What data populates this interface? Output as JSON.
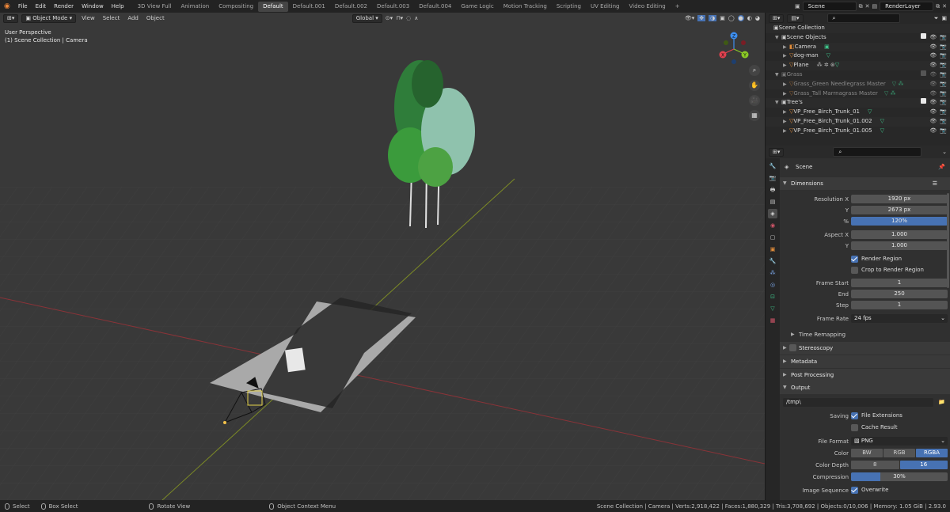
{
  "menubar": {
    "items": [
      "File",
      "Edit",
      "Render",
      "Window",
      "Help"
    ]
  },
  "workspaces": {
    "tabs": [
      "3D View Full",
      "Animation",
      "Compositing",
      "Default",
      "Default.001",
      "Default.002",
      "Default.003",
      "Default.004",
      "Game Logic",
      "Motion Tracking",
      "Scripting",
      "UV Editing",
      "Video Editing"
    ],
    "active": "Default",
    "add": "+"
  },
  "scene_field": "Scene",
  "layer_field": "RenderLayer",
  "viewport": {
    "mode": "Object Mode",
    "menus": [
      "View",
      "Select",
      "Add",
      "Object"
    ],
    "orientation": "Global",
    "perspective": "User Perspective",
    "context": "(1) Scene Collection | Camera",
    "gizmo": {
      "x": "X",
      "y": "Y",
      "z": "Z"
    }
  },
  "outliner": {
    "rows": [
      {
        "name": "Scene Collection",
        "level": 0,
        "type": "collection"
      },
      {
        "name": "Scene Objects",
        "level": 1,
        "type": "collection",
        "checked": true
      },
      {
        "name": "Camera",
        "level": 2,
        "type": "camera"
      },
      {
        "name": "dog-man",
        "level": 2,
        "type": "object"
      },
      {
        "name": "Plane",
        "level": 2,
        "type": "object"
      },
      {
        "name": "Grass",
        "level": 1,
        "type": "collection",
        "checked": false,
        "dim": true
      },
      {
        "name": "Grass_Green Needlegrass Master",
        "level": 2,
        "type": "object",
        "dim": true
      },
      {
        "name": "Grass_Tall Marrnagrass Master",
        "level": 2,
        "type": "object",
        "dim": true
      },
      {
        "name": "Tree's",
        "level": 1,
        "type": "collection",
        "checked": true
      },
      {
        "name": "VP_Free_Birch_Trunk_01",
        "level": 2,
        "type": "object"
      },
      {
        "name": "VP_Free_Birch_Trunk_01.002",
        "level": 2,
        "type": "object"
      },
      {
        "name": "VP_Free_Birch_Trunk_01.005",
        "level": 2,
        "type": "object"
      }
    ]
  },
  "properties": {
    "context": "Scene",
    "dimensions": {
      "title": "Dimensions",
      "resolution_x_label": "Resolution X",
      "resolution_x": "1920 px",
      "resolution_y_label": "Y",
      "resolution_y": "2673 px",
      "percent_label": "%",
      "percent": "120%",
      "percent_fill": 1.0,
      "aspect_x_label": "Aspect X",
      "aspect_x": "1.000",
      "aspect_y_label": "Y",
      "aspect_y": "1.000",
      "render_region": "Render Region",
      "crop_region": "Crop to Render Region",
      "frame_start_label": "Frame Start",
      "frame_start": "1",
      "end_label": "End",
      "frame_end": "250",
      "step_label": "Step",
      "frame_step": "1",
      "frame_rate_label": "Frame Rate",
      "frame_rate": "24 fps",
      "time_remapping": "Time Remapping"
    },
    "panels": [
      "Stereoscopy",
      "Metadata",
      "Post Processing",
      "Output"
    ],
    "output": {
      "path": "/tmp\\",
      "saving_label": "Saving",
      "file_extensions": "File Extensions",
      "cache_result": "Cache Result",
      "file_format_label": "File Format",
      "file_format": "PNG",
      "color_label": "Color",
      "color_options": [
        "BW",
        "RGB",
        "RGBA"
      ],
      "color_selected": "RGBA",
      "depth_label": "Color Depth",
      "depth_options": [
        "8",
        "16"
      ],
      "depth_selected": "16",
      "compression_label": "Compression",
      "compression": "30%",
      "compression_fill": 0.3,
      "image_sequence_label": "Image Sequence",
      "overwrite": "Overwrite"
    }
  },
  "statusbar": {
    "select": "Select",
    "box_select": "Box Select",
    "rotate": "Rotate View",
    "context_menu": "Object Context Menu",
    "stats": "Scene Collection | Camera | Verts:2,918,422 | Faces:1,880,329 | Tris:3,708,692 | Objects:0/10,006 | Memory: 1.05 GiB | 2.93.0"
  },
  "colors": {
    "accent": "#4772b3",
    "x_axis": "#e2414f",
    "y_axis": "#8ac926",
    "z_axis": "#3d8ff0"
  }
}
